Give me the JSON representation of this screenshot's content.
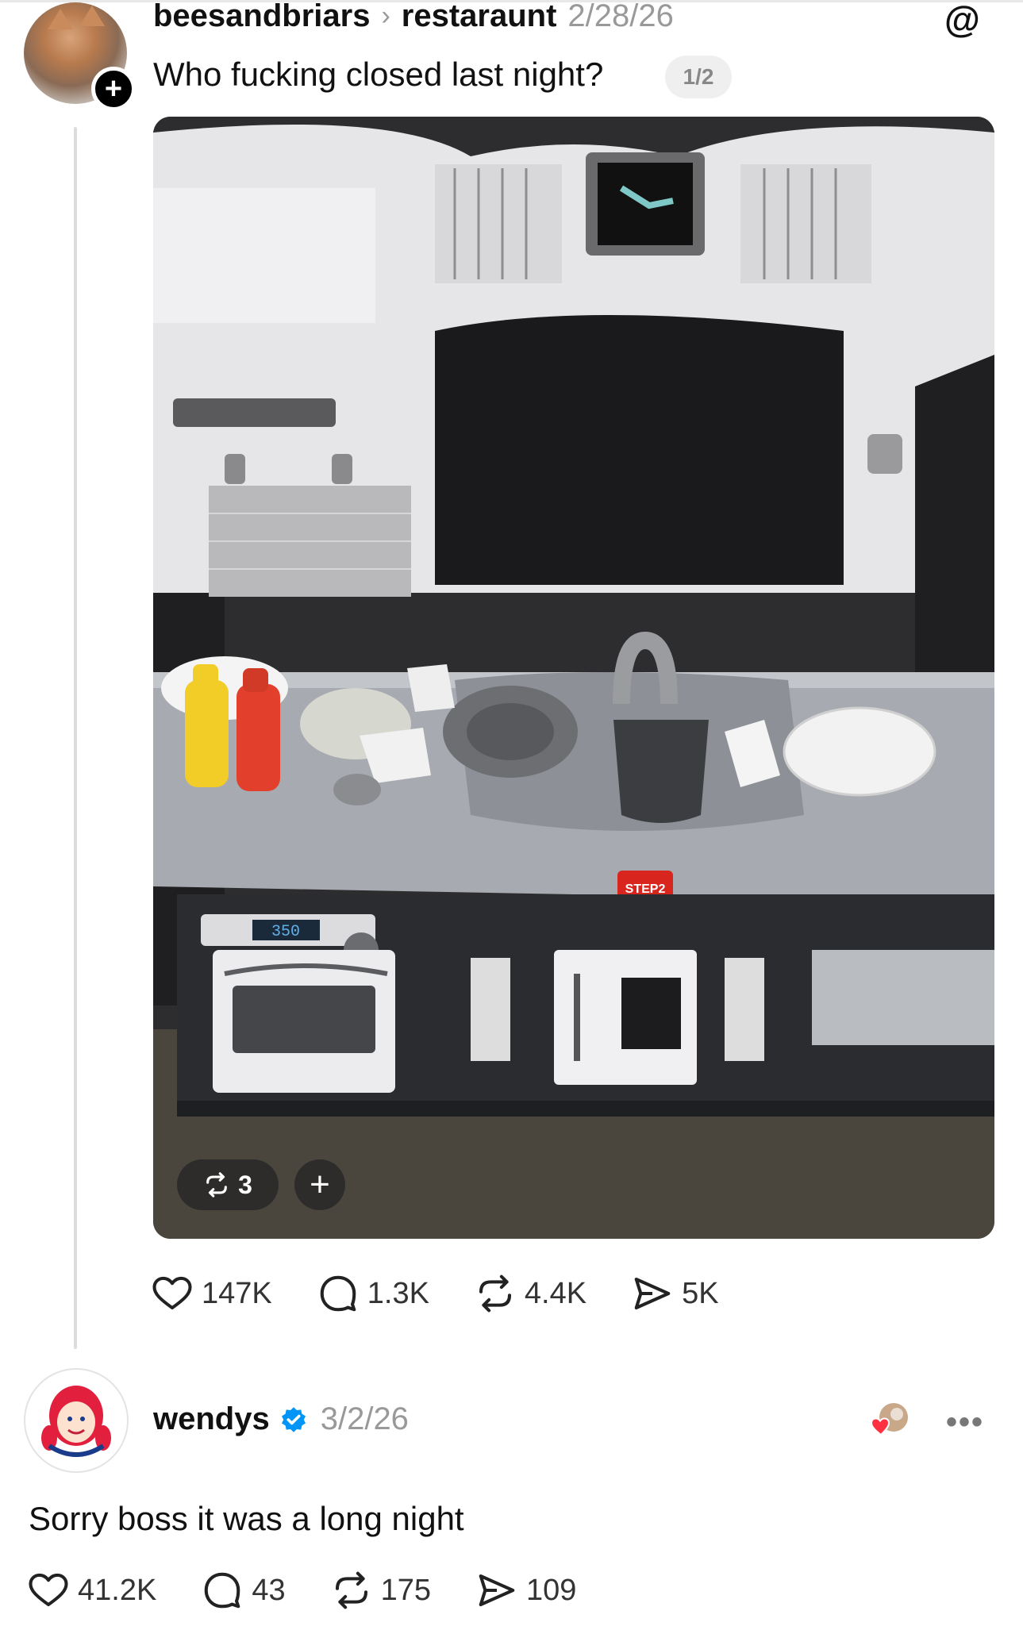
{
  "post": {
    "username": "beesandbriars",
    "separator": "›",
    "community": "restaraunt",
    "date": "2/28/26",
    "text": "Who fucking closed last night?",
    "page_indicator": "1/2",
    "image": {
      "repost_count": "3",
      "add_label": "+",
      "oven_display": "350",
      "brand_badge": "STEP2"
    },
    "stats": {
      "likes": "147K",
      "replies": "1.3K",
      "reposts": "4.4K",
      "shares": "5K"
    }
  },
  "reply": {
    "username": "wendys",
    "date": "3/2/26",
    "text": "Sorry boss it was a long night",
    "stats": {
      "likes": "41.2K",
      "replies": "43",
      "reposts": "175",
      "shares": "109"
    }
  },
  "colors": {
    "verified_blue": "#0095f6",
    "like_red": "#ff3040",
    "muted_gray": "#999999",
    "wendys_red": "#e2203d"
  },
  "icons": [
    "plus-icon",
    "threads-logo-icon",
    "heart-icon",
    "comment-icon",
    "repost-icon",
    "share-icon",
    "verified-badge-icon",
    "more-icon"
  ]
}
